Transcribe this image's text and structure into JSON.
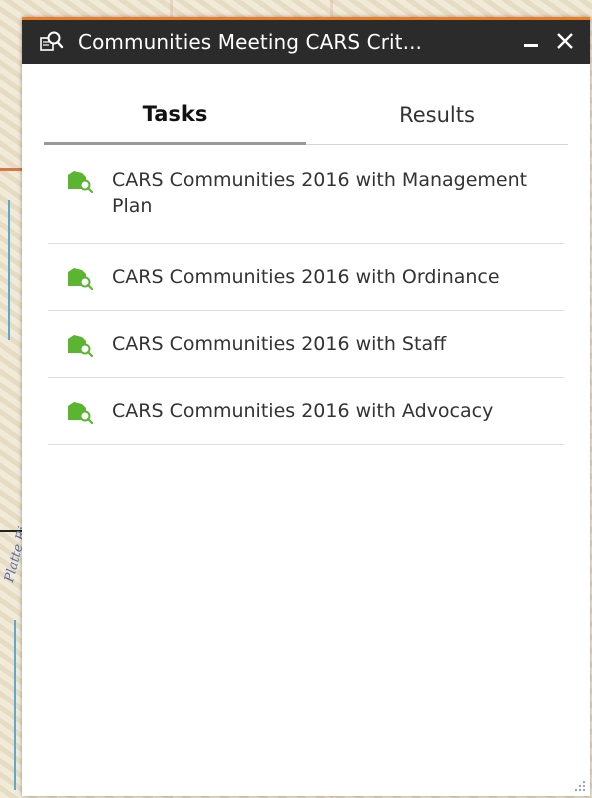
{
  "window": {
    "title": "Communities Meeting CARS Crit...",
    "title_icon": "search-layer-icon",
    "minimize_icon": "minimize-icon",
    "close_icon": "close-icon"
  },
  "tabs": [
    {
      "label": "Tasks",
      "active": true
    },
    {
      "label": "Results",
      "active": false
    }
  ],
  "tasks": [
    {
      "label": "CARS Communities 2016 with Management Plan",
      "icon": "query-task-icon"
    },
    {
      "label": "CARS Communities 2016 with Ordinance",
      "icon": "query-task-icon"
    },
    {
      "label": "CARS Communities 2016 with Staff",
      "icon": "query-task-icon"
    },
    {
      "label": "CARS Communities 2016 with Advocacy",
      "icon": "query-task-icon"
    }
  ],
  "background": {
    "map_label": "Platte Ri"
  },
  "colors": {
    "accent": "#f07a1e",
    "titlebar": "#2b2b2b",
    "task_icon": "#5cb531"
  }
}
